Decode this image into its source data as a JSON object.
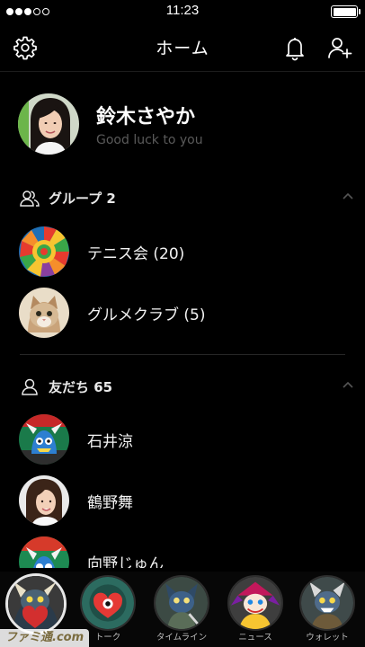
{
  "status_bar": {
    "time": "11:23",
    "signal_dots": 5,
    "signal_filled": 3,
    "battery_level": 1.0
  },
  "header": {
    "title": "ホーム",
    "left_icon": "gear-icon",
    "right_icons": [
      "bell-icon",
      "add-friend-icon"
    ]
  },
  "profile": {
    "name": "鈴木さやか",
    "status_message": "Good luck to you"
  },
  "groups": {
    "title": "グループ 2",
    "icon": "group-icon",
    "expanded": true,
    "items": [
      {
        "label": "テニス会 (20)",
        "avatar": "colorful-mosaic"
      },
      {
        "label": "グルメクラブ (5)",
        "avatar": "cat-photo"
      }
    ]
  },
  "friends": {
    "title": "友だち 65",
    "icon": "person-icon",
    "expanded": true,
    "items": [
      {
        "label": "石井涼",
        "avatar": "monster-character"
      },
      {
        "label": "鶴野舞",
        "avatar": "woman-photo"
      },
      {
        "label": "向野じゅん",
        "avatar": "monster-character-2"
      }
    ]
  },
  "tabs": [
    {
      "label": "",
      "active": true,
      "avatar": "dragon-heart"
    },
    {
      "label": "トーク",
      "active": false,
      "avatar": "heart-creature"
    },
    {
      "label": "タイムライン",
      "active": false,
      "avatar": "cat-ninja"
    },
    {
      "label": "ニュース",
      "active": false,
      "avatar": "jester"
    },
    {
      "label": "ウォレット",
      "active": false,
      "avatar": "wolf-warrior"
    }
  ],
  "watermark": "ファミ通.com",
  "colors": {
    "background": "#000000",
    "text_primary": "#ffffff",
    "text_secondary": "#5a5a5a",
    "divider": "#262626",
    "active_tab_ring": "#e7e7e7"
  }
}
